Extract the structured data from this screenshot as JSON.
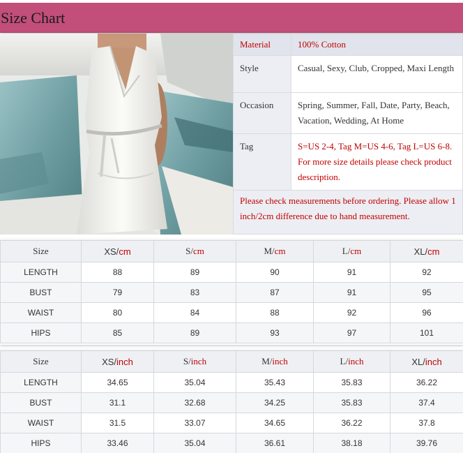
{
  "header": {
    "title": "Size Chart"
  },
  "info": {
    "material": {
      "label": "Material",
      "value": "100% Cotton"
    },
    "style": {
      "label": "Style",
      "value": "Casual, Sexy, Club, Cropped, Maxi Length"
    },
    "occasion": {
      "label": "Occasion",
      "value": "Spring, Summer, Fall, Date, Party, Beach, Vacation, Wedding, At Home"
    },
    "tag": {
      "label": "Tag",
      "value": "S=US 2-4, Tag M=US 4-6, Tag L=US 6-8. For more size details please check product description."
    },
    "note": "Please check measurements before ordering. Please allow 1 inch/2cm difference due to hand measurement."
  },
  "cm_table": {
    "header": {
      "label": "Size",
      "unit": "cm",
      "sizes": [
        "XS/",
        "S/",
        "M/",
        "L/",
        "XL/"
      ]
    },
    "rows": [
      {
        "label": "LENGTH",
        "values": [
          "88",
          "89",
          "90",
          "91",
          "92"
        ]
      },
      {
        "label": "BUST",
        "values": [
          "79",
          "83",
          "87",
          "91",
          "95"
        ]
      },
      {
        "label": "WAIST",
        "values": [
          "80",
          "84",
          "88",
          "92",
          "96"
        ]
      },
      {
        "label": "HIPS",
        "values": [
          "85",
          "89",
          "93",
          "97",
          "101"
        ]
      }
    ]
  },
  "inch_table": {
    "header": {
      "label": "Size",
      "unit": "inch",
      "sizes": [
        "XS/",
        "S/",
        "M/",
        "L/",
        "XL/"
      ]
    },
    "rows": [
      {
        "label": "LENGTH",
        "values": [
          "34.65",
          "35.04",
          "35.43",
          "35.83",
          "36.22"
        ]
      },
      {
        "label": "BUST",
        "values": [
          "31.1",
          "32.68",
          "34.25",
          "35.83",
          "37.4"
        ]
      },
      {
        "label": "WAIST",
        "values": [
          "31.5",
          "33.07",
          "34.65",
          "36.22",
          "37.8"
        ]
      },
      {
        "label": "HIPS",
        "values": [
          "33.46",
          "35.04",
          "36.61",
          "38.18",
          "39.76"
        ]
      }
    ]
  },
  "colors": {
    "header_bg": "#c14f79",
    "accent_red": "#c00000"
  }
}
